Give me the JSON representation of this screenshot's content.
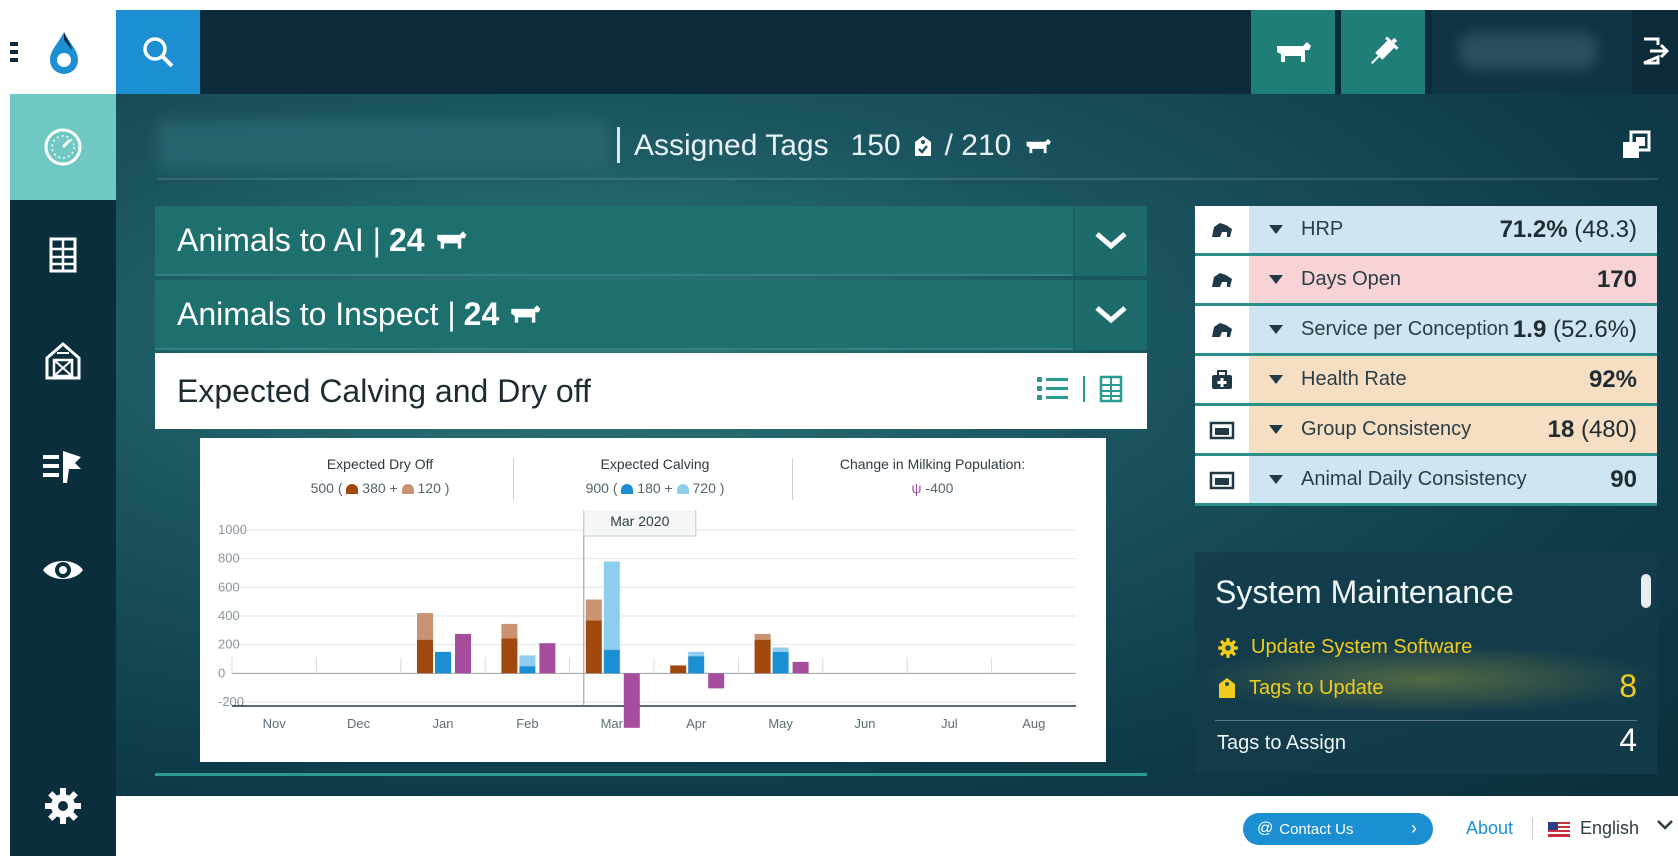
{
  "header": {
    "assigned_label": "Assigned Tags",
    "assigned_count": "150",
    "assigned_sep": "/ 210"
  },
  "panels": {
    "ai": {
      "label": "Animals to AI |",
      "count": "24"
    },
    "inspect": {
      "label": "Animals to Inspect |",
      "count": "24"
    },
    "calving": {
      "title": "Expected Calving and Dry off"
    }
  },
  "chart_legend": {
    "dry_off": {
      "title": "Expected Dry Off",
      "summary_total": "500 (",
      "summary_a": "380",
      "plus": "+",
      "summary_b": "120 )"
    },
    "calving": {
      "title": "Expected Calving",
      "summary_total": "900 (",
      "summary_a": "180",
      "plus": "+",
      "summary_b": "720 )"
    },
    "milking": {
      "title": "Change in Milking Population:",
      "value": "-400"
    }
  },
  "chart_data": {
    "type": "bar",
    "categories": [
      "Nov",
      "Dec",
      "Jan",
      "Feb",
      "Mar",
      "Apr",
      "May",
      "Jun",
      "Jul",
      "Aug"
    ],
    "ylim": [
      -200,
      1000
    ],
    "yticks": [
      "1000",
      "800",
      "600",
      "400",
      "200",
      "0",
      "-200"
    ],
    "tooltip": "Mar 2020",
    "series": [
      {
        "key": "dryoff_main",
        "values": [
          0,
          0,
          235,
          245,
          370,
          55,
          235,
          0,
          0,
          0
        ],
        "color": "#a0480d"
      },
      {
        "key": "dryoff_extra",
        "values": [
          0,
          0,
          185,
          100,
          145,
          0,
          40,
          0,
          0,
          0
        ],
        "color": "#c99272"
      },
      {
        "key": "calving_main",
        "values": [
          0,
          0,
          150,
          50,
          165,
          120,
          150,
          0,
          0,
          0
        ],
        "color": "#1c8fd2"
      },
      {
        "key": "calving_extra",
        "values": [
          0,
          0,
          0,
          75,
          615,
          30,
          30,
          0,
          0,
          0
        ],
        "color": "#8fcdef"
      },
      {
        "key": "milking_change",
        "values": [
          0,
          0,
          275,
          210,
          -380,
          -105,
          80,
          0,
          0,
          0
        ],
        "color": "#a64d9e"
      }
    ]
  },
  "kpis": [
    {
      "name": "HRP",
      "value": "71.2%",
      "extra": "(48.3)",
      "bg": "#cfe5f2"
    },
    {
      "name": "Days Open",
      "value": "170",
      "extra": "",
      "bg": "#f7d3d5"
    },
    {
      "name": "Service per Conception",
      "value": "1.9",
      "extra": "(52.6%)",
      "bg": "#cfe5f2"
    },
    {
      "name": "Health Rate",
      "value": "92%",
      "extra": "",
      "bg": "#f5dec2"
    },
    {
      "name": "Group Consistency",
      "value": "18",
      "extra": "(480)",
      "bg": "#f5dec2"
    },
    {
      "name": "Animal Daily Consistency",
      "value": "90",
      "extra": "",
      "bg": "#cfe5f2"
    }
  ],
  "maintenance": {
    "title": "System Maintenance",
    "update_software": "Update System Software",
    "tags_to_update": "Tags to Update",
    "tags_to_update_count": "8",
    "tags_to_assign": "Tags to Assign",
    "tags_to_assign_count": "4"
  },
  "footer": {
    "contact": "Contact Us",
    "about": "About",
    "language": "English"
  },
  "colors": {
    "accent_blue": "#1c8fd2",
    "teal": "#1e706f",
    "rail": "#0b2e3d",
    "maintenance_yellow": "#f0cc1d"
  }
}
